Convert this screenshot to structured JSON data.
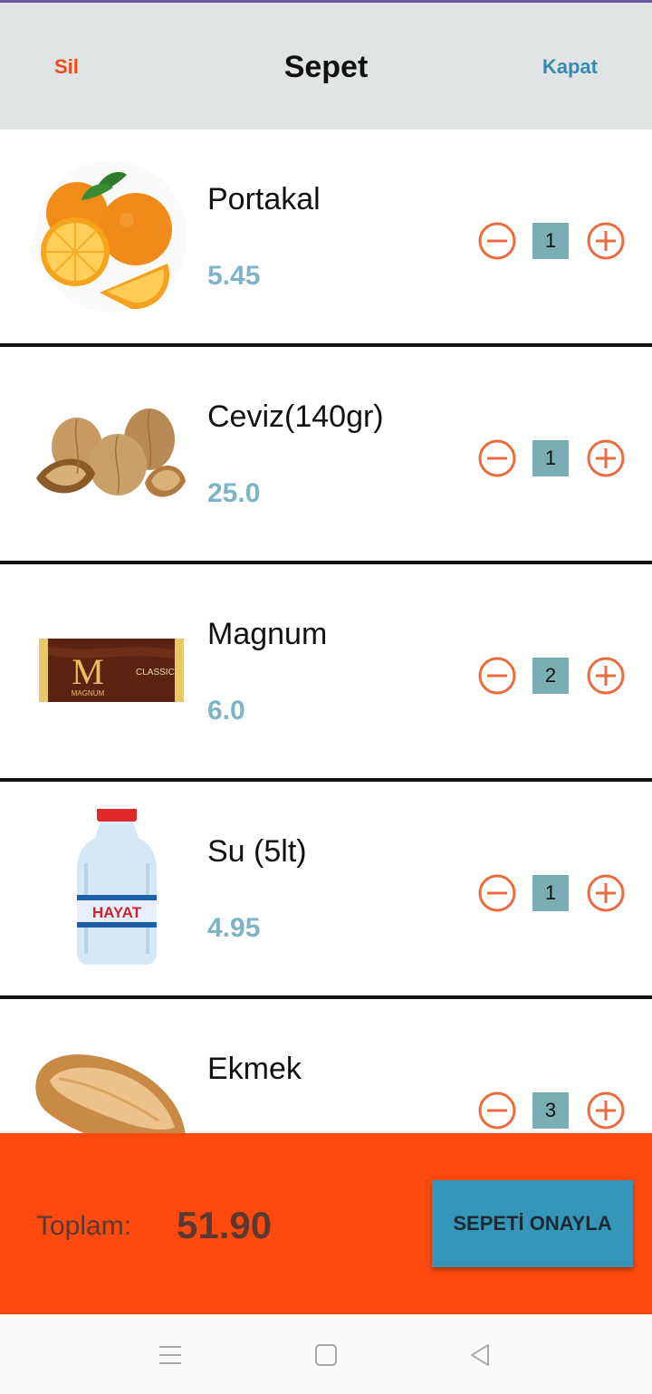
{
  "header": {
    "left_action": "Sil",
    "title": "Sepet",
    "right_action": "Kapat"
  },
  "cart": {
    "items": [
      {
        "name": "Portakal",
        "price": "5.45",
        "quantity": "1",
        "image": "orange-image"
      },
      {
        "name": "Ceviz(140gr)",
        "price": "25.0",
        "quantity": "1",
        "image": "walnut-image"
      },
      {
        "name": "Magnum",
        "price": "6.0",
        "quantity": "2",
        "image": "magnum-image"
      },
      {
        "name": "Su (5lt)",
        "price": "4.95",
        "quantity": "1",
        "image": "water-bottle-image"
      },
      {
        "name": "Ekmek",
        "price": "",
        "quantity": "3",
        "image": "bread-image"
      }
    ]
  },
  "magnum_wrapper": {
    "brand": "M",
    "sub": "MAGNUM",
    "variant": "CLASSIC"
  },
  "water_label": {
    "brand": "HAYAT"
  },
  "footer": {
    "total_label": "Toplam:",
    "total_value": "51.90",
    "confirm_label": "SEPETİ ONAYLA"
  },
  "colors": {
    "header_bg": "#e1e4e5",
    "accent_red": "#ee4a1c",
    "accent_blue": "#3a8ab0",
    "price": "#7fb3c6",
    "footer_bg": "#ff4a0f",
    "confirm_bg": "#3596b8",
    "qty_bg": "#7aacb4"
  },
  "navbar": {
    "icons": [
      "menu-icon",
      "home-square-icon",
      "back-triangle-icon"
    ]
  }
}
